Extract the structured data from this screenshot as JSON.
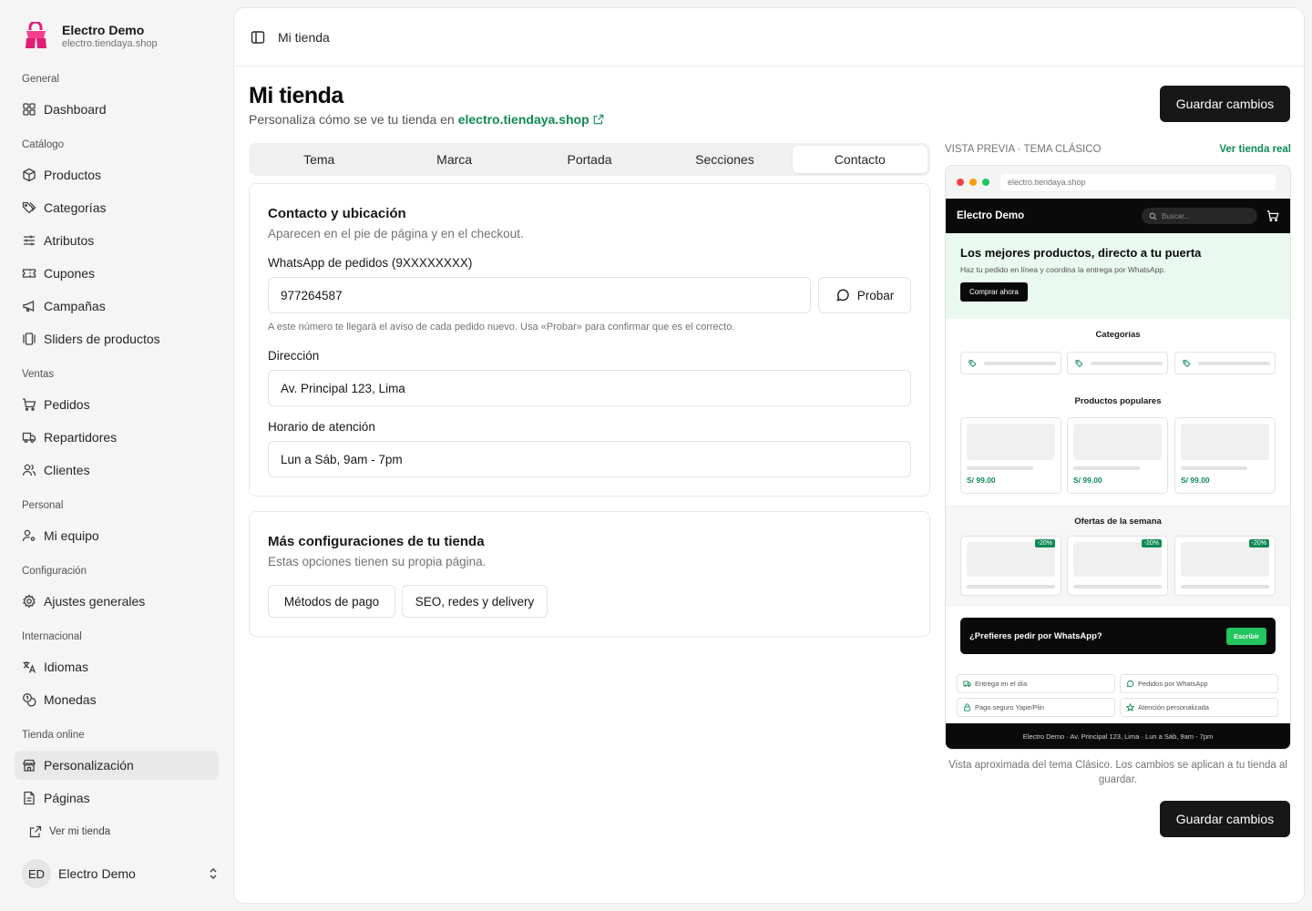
{
  "sidebar": {
    "store_name": "Electro Demo",
    "store_url": "electro.tiendaya.shop",
    "groups": {
      "general": "General",
      "catalogo": "Catálogo",
      "ventas": "Ventas",
      "personal": "Personal",
      "configuracion": "Configuración",
      "internacional": "Internacional",
      "tienda_online": "Tienda online"
    },
    "items": {
      "dashboard": "Dashboard",
      "productos": "Productos",
      "categorias": "Categorías",
      "atributos": "Atributos",
      "cupones": "Cupones",
      "campanas": "Campañas",
      "sliders": "Sliders de productos",
      "pedidos": "Pedidos",
      "repartidores": "Repartidores",
      "clientes": "Clientes",
      "mi_equipo": "Mi equipo",
      "ajustes": "Ajustes generales",
      "idiomas": "Idiomas",
      "monedas": "Monedas",
      "personalizacion": "Personalización",
      "paginas": "Páginas"
    },
    "view_store": "Ver mi tienda",
    "user": {
      "initials": "ED",
      "name": "Electro Demo"
    }
  },
  "topbar": {
    "breadcrumb": "Mi tienda"
  },
  "page": {
    "title": "Mi tienda",
    "subtitle": "Personaliza cómo se ve tu tienda en",
    "store_link": "electro.tiendaya.shop",
    "save_label": "Guardar cambios"
  },
  "tabs": [
    "Tema",
    "Marca",
    "Portada",
    "Secciones",
    "Contacto"
  ],
  "active_tab": "Contacto",
  "contact_card": {
    "title": "Contacto y ubicación",
    "description": "Aparecen en el pie de página y en el checkout.",
    "whatsapp_label": "WhatsApp de pedidos (9XXXXXXXX)",
    "whatsapp_value": "977264587",
    "try_label": "Probar",
    "whatsapp_hint": "A este número te llegará el aviso de cada pedido nuevo. Usa «Probar» para confirmar que es el correcto.",
    "address_label": "Dirección",
    "address_value": "Av. Principal 123, Lima",
    "hours_label": "Horario de atención",
    "hours_value": "Lun a Sáb, 9am - 7pm"
  },
  "more_card": {
    "title": "Más configuraciones de tu tienda",
    "description": "Estas opciones tienen su propia página.",
    "buttons": [
      "Métodos de pago",
      "SEO, redes y delivery"
    ]
  },
  "preview": {
    "label": "VISTA PREVIA · TEMA CLÁSICO",
    "view_real": "Ver tienda real",
    "url": "electro.tiendaya.shop",
    "store_name": "Electro Demo",
    "search_placeholder": "Buscar...",
    "hero_title": "Los mejores productos, directo a tu puerta",
    "hero_sub": "Haz tu pedido en línea y coordina la entrega por WhatsApp.",
    "hero_button": "Comprar ahora",
    "categories_title": "Categorías",
    "popular_title": "Productos populares",
    "price": "S/ 99.00",
    "offers_title": "Ofertas de la semana",
    "discount": "-20%",
    "whatsapp_cta": "¿Prefieres pedir por WhatsApp?",
    "whatsapp_button": "Escribir",
    "features": [
      "Entrega en el día",
      "Pedidos por WhatsApp",
      "Pago seguro Yape/Plin",
      "Atención personalizada"
    ],
    "footer": "Electro Demo · Av. Principal 123, Lima · Lun a Sáb, 9am - 7pm",
    "caption": "Vista aproximada del tema Clásico. Los cambios se aplican a tu tienda al guardar."
  },
  "colors": {
    "accent_green": "#0f8a55",
    "dark": "#171717",
    "brand_pink": "#e11d74",
    "whatsapp_green": "#22c55e"
  }
}
